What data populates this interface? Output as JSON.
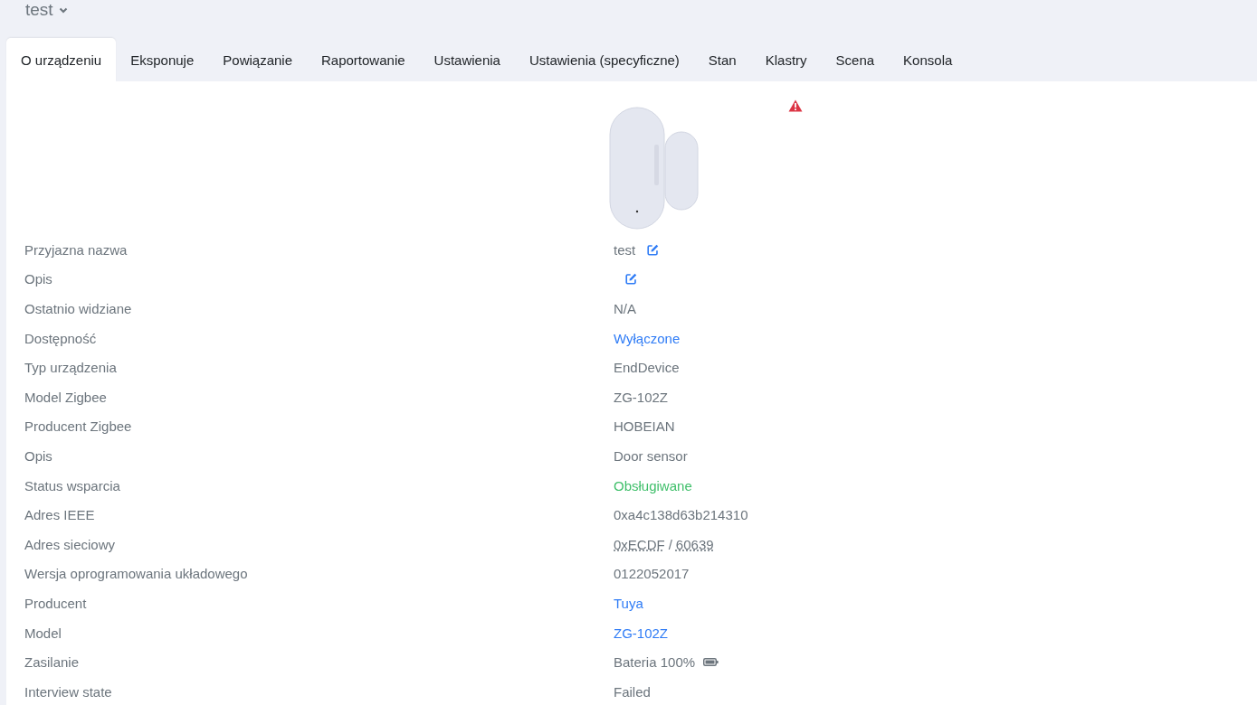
{
  "header": {
    "title": "test"
  },
  "tabs": [
    {
      "label": "O urządzeniu",
      "selected": true
    },
    {
      "label": "Eksponuje",
      "selected": false
    },
    {
      "label": "Powiązanie",
      "selected": false
    },
    {
      "label": "Raportowanie",
      "selected": false
    },
    {
      "label": "Ustawienia",
      "selected": false
    },
    {
      "label": "Ustawienia (specyficzne)",
      "selected": false
    },
    {
      "label": "Stan",
      "selected": false
    },
    {
      "label": "Klastry",
      "selected": false
    },
    {
      "label": "Scena",
      "selected": false
    },
    {
      "label": "Konsola",
      "selected": false
    }
  ],
  "device_image": {
    "warning": true
  },
  "rows": [
    {
      "kind": "editable",
      "label": "Przyjazna nazwa",
      "value": "test"
    },
    {
      "kind": "editable",
      "label": "Opis",
      "value": ""
    },
    {
      "kind": "text",
      "label": "Ostatnio widziane",
      "value": "N/A"
    },
    {
      "kind": "link",
      "label": "Dostępność",
      "value": "Wyłączone"
    },
    {
      "kind": "text",
      "label": "Typ urządzenia",
      "value": "EndDevice"
    },
    {
      "kind": "text",
      "label": "Model Zigbee",
      "value": "ZG-102Z"
    },
    {
      "kind": "text",
      "label": "Producent Zigbee",
      "value": "HOBEIAN"
    },
    {
      "kind": "text",
      "label": "Opis",
      "value": "Door sensor"
    },
    {
      "kind": "success",
      "label": "Status wsparcia",
      "value": "Obsługiwane"
    },
    {
      "kind": "text",
      "label": "Adres IEEE",
      "value": "0xa4c138d63b214310"
    },
    {
      "kind": "address",
      "label": "Adres sieciowy",
      "parts": [
        "0xECDF",
        "60639"
      ],
      "separator": "/"
    },
    {
      "kind": "text",
      "label": "Wersja oprogramowania układowego",
      "value": "0122052017"
    },
    {
      "kind": "link",
      "label": "Producent",
      "value": "Tuya"
    },
    {
      "kind": "link",
      "label": "Model",
      "value": "ZG-102Z"
    },
    {
      "kind": "battery",
      "label": "Zasilanie",
      "value": "Bateria 100%"
    },
    {
      "kind": "text",
      "label": "Interview state",
      "value": "Failed"
    }
  ]
}
